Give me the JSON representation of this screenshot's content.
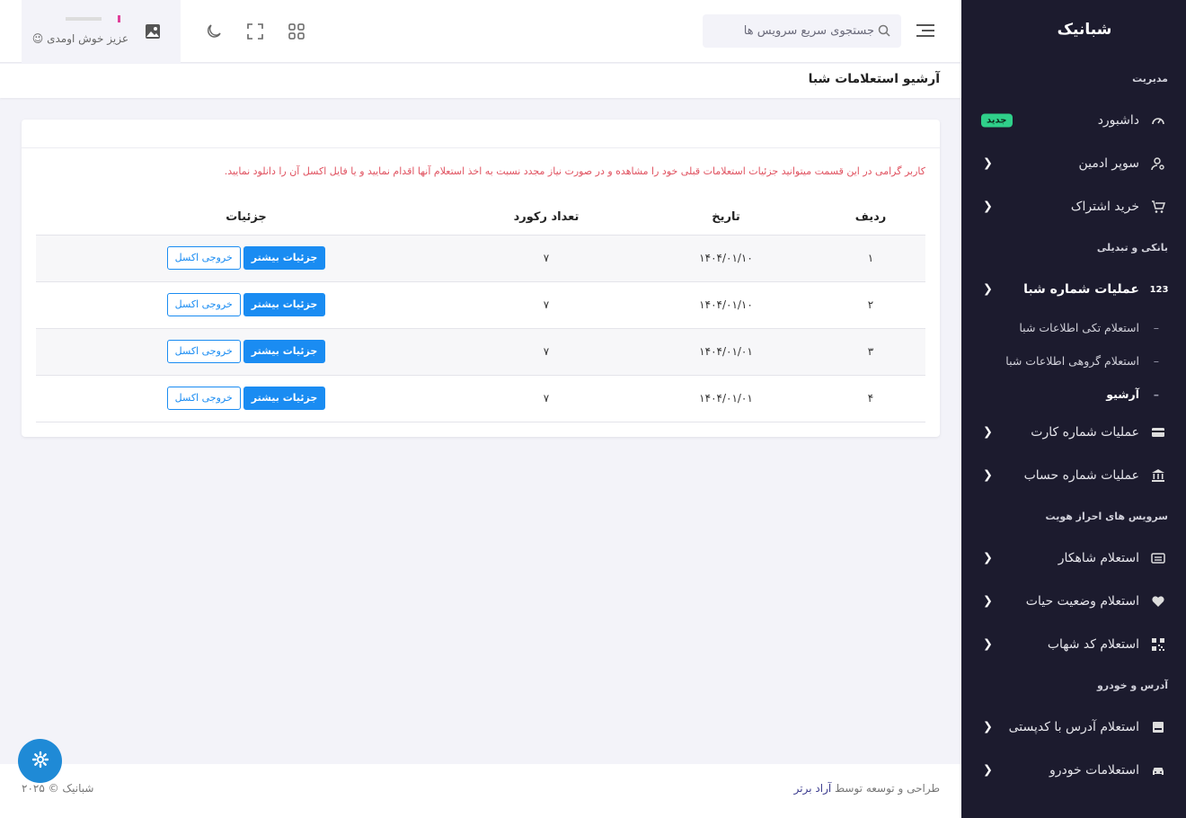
{
  "brand": {
    "text_a": "شبا",
    "text_b": "نیک"
  },
  "topbar": {
    "search_placeholder": "جستجوی سریع سرویس ها",
    "user_greeting": "عزیز خوش اومدی 😉"
  },
  "page": {
    "title": "آرشیو استعلامات شبا"
  },
  "card": {
    "notice": "کاربر گرامی در این قسمت میتوانید جزئیات استعلامات قبلی خود را مشاهده و در صورت نیاز مجدد نسبت به اخذ استعلام آنها اقدام نمایید و یا فایل اکسل آن را دانلود نمایید."
  },
  "table": {
    "headers": [
      "ردیف",
      "تاریخ",
      "تعداد رکورد",
      "جزئیات"
    ],
    "rows": [
      {
        "index": "۱",
        "date": "۱۴۰۴/۰۱/۱۰",
        "count": "۷",
        "details_label": "جزئیات بیشتر",
        "excel_label": "خروجی اکسل"
      },
      {
        "index": "۲",
        "date": "۱۴۰۴/۰۱/۱۰",
        "count": "۷",
        "details_label": "جزئیات بیشتر",
        "excel_label": "خروجی اکسل"
      },
      {
        "index": "۳",
        "date": "۱۴۰۴/۰۱/۰۱",
        "count": "۷",
        "details_label": "جزئیات بیشتر",
        "excel_label": "خروجی اکسل"
      },
      {
        "index": "۴",
        "date": "۱۴۰۴/۰۱/۰۱",
        "count": "۷",
        "details_label": "جزئیات بیشتر",
        "excel_label": "خروجی اکسل"
      }
    ]
  },
  "sidebar": {
    "section_manage": "مدیریت",
    "dashboard": "داشبورد",
    "dashboard_badge": "جدید",
    "super_admin": "سوپر ادمین",
    "buy_subscription": "خرید اشتراک",
    "section_banking": "بانکی و تبدیلی",
    "sheba_ops": "عملیات شماره شبا",
    "sheba_ops_icon_text": "123",
    "sub_single": "استعلام تکی اطلاعات شبا",
    "sub_group": "استعلام گروهی اطلاعات شبا",
    "sub_archive": "آرشیو",
    "card_ops": "عملیات شماره کارت",
    "account_ops": "عملیات شماره حساب",
    "section_identity": "سرویس های احراز هویت",
    "shahkar": "استعلام شاهکار",
    "life_status": "استعلام وضعیت حیات",
    "shahab": "استعلام کد شهاب",
    "section_address": "آدرس و خودرو",
    "postal": "استعلام آدرس با کدپستی",
    "vehicle": "استعلامات خودرو"
  },
  "footer": {
    "credit_prefix": "طراحی و توسعه توسط",
    "credit_link": "آراد برتر",
    "copyright": "شبانیک © ۲۰۲۵"
  },
  "colors": {
    "accent": "#1a8cf2",
    "sidebar_bg": "#1c1b2e",
    "notice": "#e05260",
    "badge": "#2fd08a"
  }
}
